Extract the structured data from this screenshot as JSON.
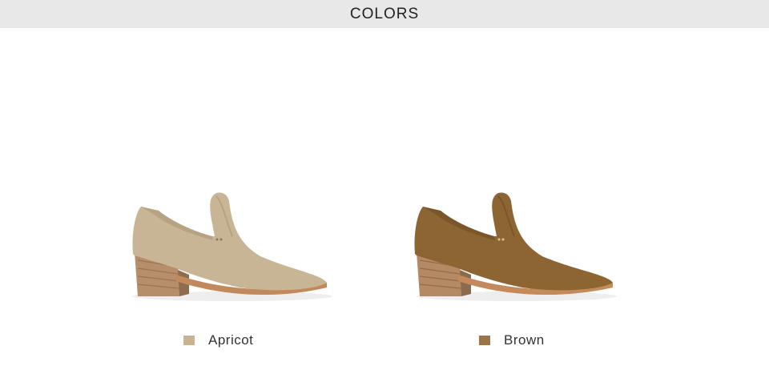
{
  "header": {
    "title": "COLORS"
  },
  "colors": [
    {
      "label": "Apricot",
      "swatch_color": "#c9b392",
      "upper_color": "#c8b596",
      "heel_color": "#b78e6a",
      "sole_color": "#c28a5c"
    },
    {
      "label": "Brown",
      "swatch_color": "#9a7548",
      "upper_color": "#8d6533",
      "heel_color": "#b48a64",
      "sole_color": "#c48a5c"
    }
  ]
}
